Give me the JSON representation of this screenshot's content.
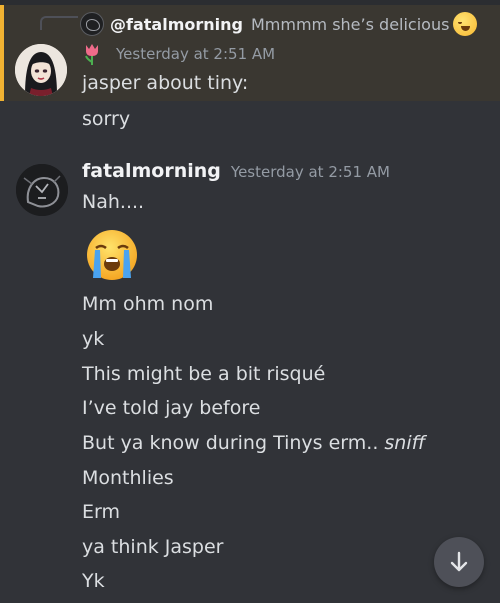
{
  "reply": {
    "author": "@fatalmorning",
    "text": "Mmmmm she’s delicious",
    "emoji_icon": "drooling-face-icon"
  },
  "message1": {
    "badge_icon": "tulip-icon",
    "timestamp": "Yesterday at 2:51 AM",
    "lines": [
      "jasper about tiny:",
      "sorry"
    ]
  },
  "message2": {
    "author": "fatalmorning",
    "timestamp": "Yesterday at 2:51 AM",
    "first_line": "Nah....",
    "emoji_icon": "loudly-crying-face-icon",
    "lines": [
      "Mm ohm nom",
      "yk",
      "This might be a bit risqué",
      "I’ve told jay before",
      "But ya know during Tinys erm..",
      "Monthlies",
      "Erm",
      "ya think Jasper",
      "Yk"
    ],
    "italic_suffix": "sniff"
  },
  "scroll_button": {
    "icon": "arrow-down-icon"
  },
  "colors": {
    "background": "#313338",
    "highlight_background": "#3a3731",
    "highlight_bar": "#f0b232",
    "timestamp": "#949ba4",
    "text": "#dbdee1"
  }
}
